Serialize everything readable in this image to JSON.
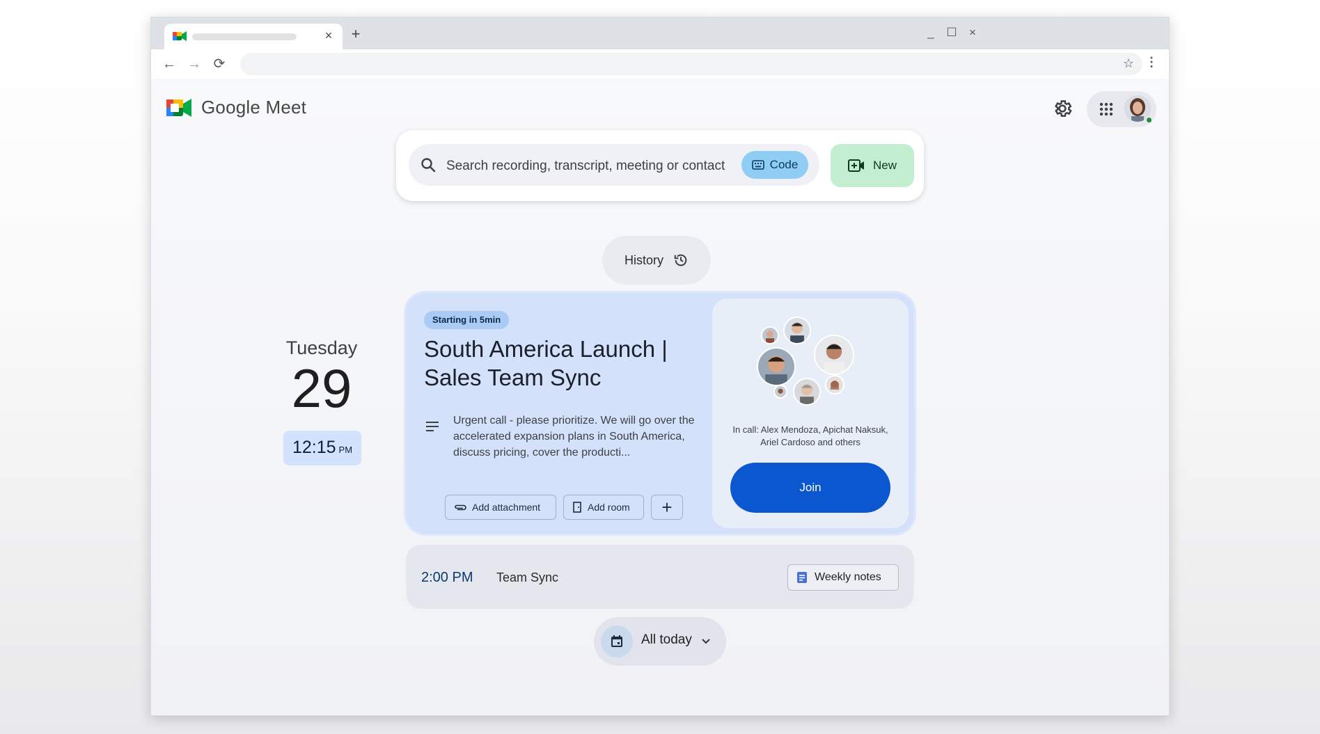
{
  "browser": {
    "tab_close": "×",
    "new_tab": "+",
    "minimize": "_",
    "maximize": "☐",
    "close": "×",
    "back": "←",
    "forward": "→",
    "reload": "⟳",
    "bookmark": "☆",
    "menu": "⋮"
  },
  "header": {
    "app_name": "Google Meet"
  },
  "search": {
    "placeholder": "Search recording, transcript, meeting or contact",
    "code_label": "Code",
    "new_label": "New"
  },
  "history": {
    "label": "History"
  },
  "date": {
    "day_name": "Tuesday",
    "day_number": "29",
    "time": "12:15",
    "ampm": "PM"
  },
  "meeting": {
    "badge": "Starting in 5min",
    "title": "South America Launch | Sales Team Sync",
    "description": "Urgent call - please prioritize. We will go over the accelerated expansion plans in South America, discuss pricing, cover the producti...",
    "add_attachment": "Add attachment",
    "add_room": "Add room",
    "add_more": "+",
    "in_call": "In call: Alex Mendoza, Apichat Naksuk, Ariel Cardoso and others",
    "join_label": "Join"
  },
  "next_meeting": {
    "time": "2:00 PM",
    "title": "Team Sync",
    "notes_label": "Weekly notes"
  },
  "filter": {
    "label": "All today"
  },
  "colors": {
    "accent": "#0b57d0",
    "card_bg": "#d3e1fb",
    "new_bg": "#c4eed0",
    "code_bg": "#8fcdf5"
  }
}
